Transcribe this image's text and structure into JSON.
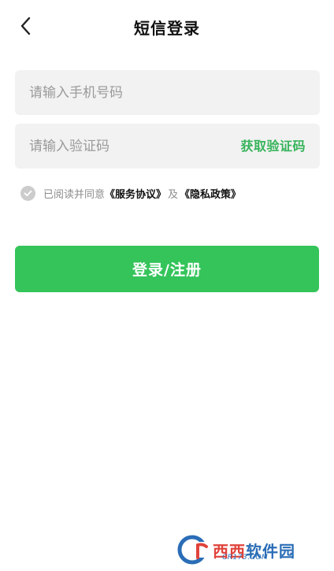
{
  "header": {
    "title": "短信登录",
    "back_icon": "chevron-left-icon"
  },
  "form": {
    "phone_placeholder": "请输入手机号码",
    "code_placeholder": "请输入验证码",
    "get_code_label": "获取验证码"
  },
  "agreement": {
    "prefix": "已阅读并同意",
    "terms_link": "《服务协议》",
    "joiner": "及",
    "privacy_link": "《隐私政策》",
    "checked": false
  },
  "login_button": {
    "label": "登录/注册"
  },
  "watermark": {
    "brand_a": "西西",
    "brand_b": "软件园",
    "site": "CR173.COM"
  },
  "colors": {
    "accent": "#34c45a",
    "accent_text": "#36b35a",
    "field_bg": "#f2f2f2",
    "placeholder": "#9a9a9a"
  }
}
